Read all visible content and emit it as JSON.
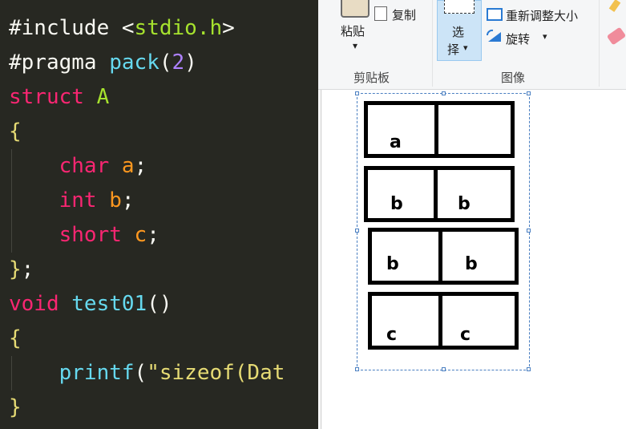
{
  "editor": {
    "lines": [
      {
        "id": "l1",
        "parts": [
          [
            "t-pp",
            "#include "
          ],
          [
            "t-punc",
            "<"
          ],
          [
            "t-ident",
            "stdio.h"
          ],
          [
            "t-punc",
            ">"
          ]
        ]
      },
      {
        "id": "l2",
        "parts": [
          [
            "t-pp",
            "#pragma "
          ],
          [
            "t-fn",
            "pack"
          ],
          [
            "t-punc",
            "("
          ],
          [
            "t-num",
            "2"
          ],
          [
            "t-punc",
            ")"
          ]
        ]
      },
      {
        "id": "l3",
        "parts": [
          [
            "t-kw",
            "struct "
          ],
          [
            "t-ident",
            "A"
          ]
        ]
      },
      {
        "id": "l4",
        "parts": [
          [
            "t-brace",
            "{"
          ]
        ]
      },
      {
        "id": "l5",
        "parts": [
          [
            "t-punc",
            "    "
          ],
          [
            "t-type",
            "char "
          ],
          [
            "t-var",
            "a"
          ],
          [
            "t-punc",
            ";"
          ]
        ]
      },
      {
        "id": "l6",
        "parts": [
          [
            "t-punc",
            "    "
          ],
          [
            "t-type",
            "int "
          ],
          [
            "t-var",
            "b"
          ],
          [
            "t-punc",
            ";"
          ]
        ]
      },
      {
        "id": "l7",
        "parts": [
          [
            "t-punc",
            "    "
          ],
          [
            "t-type",
            "short "
          ],
          [
            "t-var",
            "c"
          ],
          [
            "t-punc",
            ";"
          ]
        ]
      },
      {
        "id": "l8",
        "parts": [
          [
            "t-brace",
            "}"
          ],
          [
            "t-punc",
            ";"
          ]
        ]
      },
      {
        "id": "l9",
        "parts": [
          [
            "t-kw",
            "void "
          ],
          [
            "t-fn",
            "test01"
          ],
          [
            "t-punc",
            "()"
          ]
        ]
      },
      {
        "id": "l10",
        "parts": [
          [
            "t-brace",
            "{"
          ]
        ]
      },
      {
        "id": "l11",
        "parts": [
          [
            "t-punc",
            "    "
          ],
          [
            "t-fn",
            "printf"
          ],
          [
            "t-punc",
            "("
          ],
          [
            "t-str",
            "\"sizeof(Dat"
          ]
        ]
      },
      {
        "id": "l12",
        "parts": [
          [
            "t-brace",
            "}"
          ]
        ]
      }
    ]
  },
  "ribbon": {
    "paste_label": "粘贴",
    "copy_label": "复制",
    "select_label_1": "选",
    "select_label_2": "择",
    "dropdown_arrow": "▾",
    "resize_label": "重新调整大小",
    "rotate_label": "旋转",
    "clipboard_group": "剪贴板",
    "image_group": "图像"
  },
  "diagram": {
    "rows": [
      {
        "left": "a",
        "right": ""
      },
      {
        "left": "b",
        "right": "b"
      },
      {
        "left": "b",
        "right": "b"
      },
      {
        "left": "c",
        "right": "c"
      }
    ]
  }
}
